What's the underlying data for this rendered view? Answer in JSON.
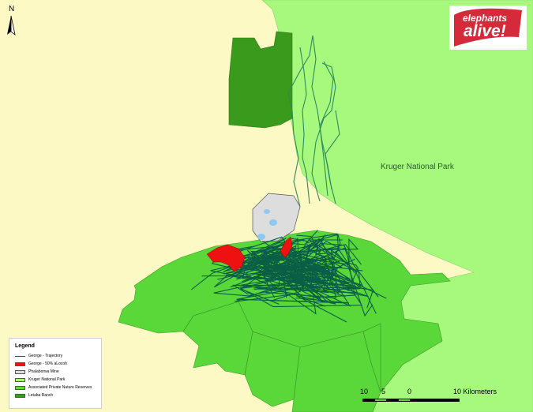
{
  "map": {
    "north_letter": "N",
    "park_label": "Kruger National Park",
    "logo": {
      "line1": "elephants",
      "line2": "alive!",
      "bg_color": "#d42a3a"
    },
    "colors": {
      "background": "#fdf9c4",
      "kruger": "#a7f97e",
      "reserves": "#5ad83a",
      "letaba": "#3a9a1c",
      "mine": "#dddddd",
      "eloc": "#ee1111",
      "trajectory": "#0b5e46",
      "kruger_track": "#2e8a5c"
    },
    "legend": {
      "title": "Legend",
      "items": [
        {
          "label": "George - Trajectory",
          "kind": "line",
          "color": "#0b5e46"
        },
        {
          "label": "George - 50% aLocoh",
          "kind": "fill",
          "color": "#ee1111"
        },
        {
          "label": "Phalaborwa Mine",
          "kind": "fill",
          "color": "#dddddd"
        },
        {
          "label": "Kruger National Park",
          "kind": "fill",
          "color": "#a7f97e"
        },
        {
          "label": "Associated Private Nature Reserves",
          "kind": "fill",
          "color": "#5ad83a"
        },
        {
          "label": "Letaba Ranch",
          "kind": "fill",
          "color": "#3a9a1c"
        }
      ]
    },
    "scale": {
      "ticks": [
        "10",
        "5",
        "0",
        "10 Kilometers"
      ]
    }
  }
}
